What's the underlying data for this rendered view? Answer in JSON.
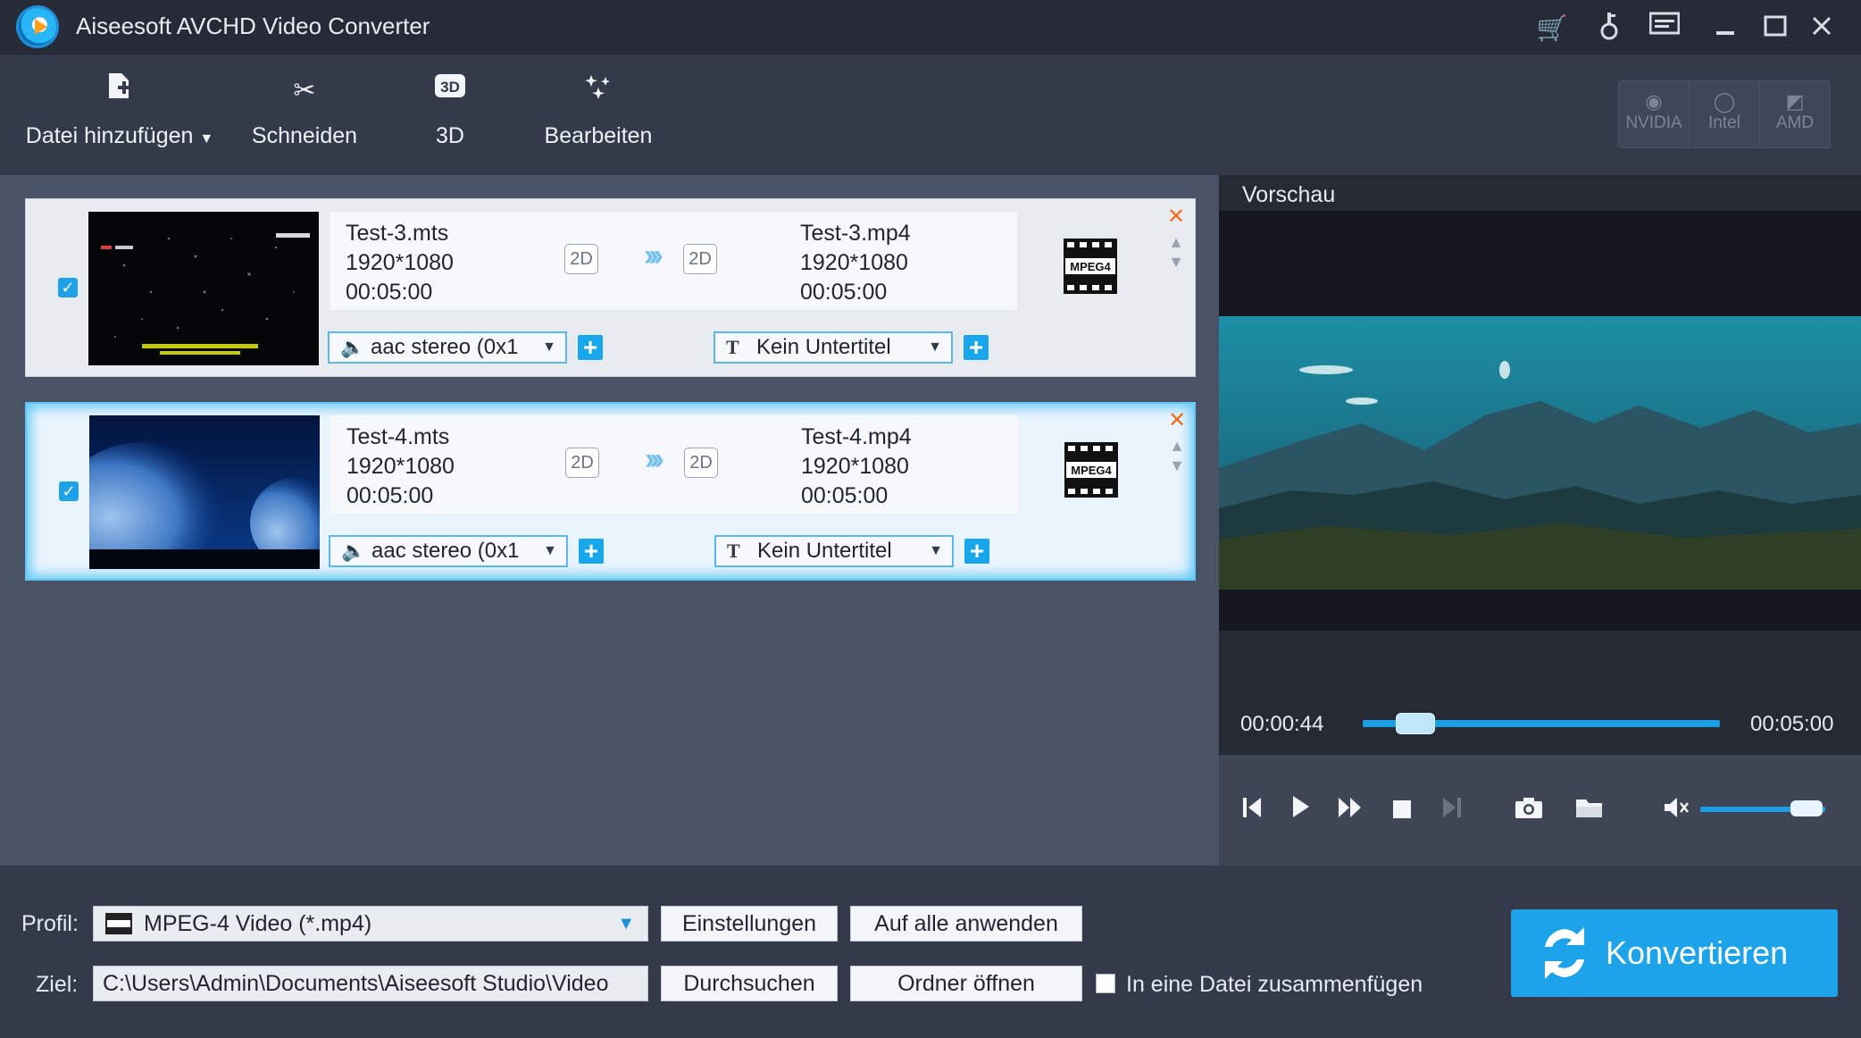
{
  "window": {
    "title": "Aiseesoft AVCHD Video Converter",
    "controls": [
      "cart-icon",
      "key-icon",
      "menu-icon",
      "minimize-icon",
      "maximize-icon",
      "close-icon"
    ]
  },
  "toolbar": {
    "add_file": "Datei hinzufügen",
    "cut": "Schneiden",
    "three_d": "3D",
    "edit": "Bearbeiten",
    "gpu": [
      {
        "label": "NVIDIA",
        "icon": "nvidia-icon"
      },
      {
        "label": "Intel",
        "icon": "intel-icon"
      },
      {
        "label": "AMD",
        "icon": "amd-icon"
      }
    ]
  },
  "files": [
    {
      "checked": true,
      "source": {
        "name": "Test-3.mts",
        "resolution": "1920*1080",
        "duration": "00:05:00",
        "mode": "2D"
      },
      "output": {
        "name": "Test-3.mp4",
        "resolution": "1920*1080",
        "duration": "00:05:00",
        "mode": "2D"
      },
      "audio": "aac stereo (0x1",
      "subtitle": "Kein Untertitel",
      "format_icon": "MPEG4"
    },
    {
      "checked": true,
      "source": {
        "name": "Test-4.mts",
        "resolution": "1920*1080",
        "duration": "00:05:00",
        "mode": "2D"
      },
      "output": {
        "name": "Test-4.mp4",
        "resolution": "1920*1080",
        "duration": "00:05:00",
        "mode": "2D"
      },
      "audio": "aac stereo (0x1",
      "subtitle": "Kein Untertitel",
      "format_icon": "MPEG4"
    }
  ],
  "preview": {
    "label": "Vorschau",
    "current_time": "00:00:44",
    "total_time": "00:05:00",
    "progress_fraction": 0.147,
    "volume_fraction": 0.85
  },
  "bottom": {
    "profile_label": "Profil:",
    "profile_value": "MPEG-4 Video (*.mp4)",
    "settings_button": "Einstellungen",
    "apply_all_button": "Auf alle anwenden",
    "dest_label": "Ziel:",
    "dest_value": "C:\\Users\\Admin\\Documents\\Aiseesoft Studio\\Video",
    "browse_button": "Durchsuchen",
    "open_folder_button": "Ordner öffnen",
    "merge_label": "In eine Datei zusammenfügen",
    "merge_checked": false,
    "convert_button": "Konvertieren"
  },
  "colors": {
    "accent": "#1ca3e9",
    "delete": "#f36b1d",
    "toolbar_bg": "#343a4a",
    "list_bg": "#4a5366"
  }
}
